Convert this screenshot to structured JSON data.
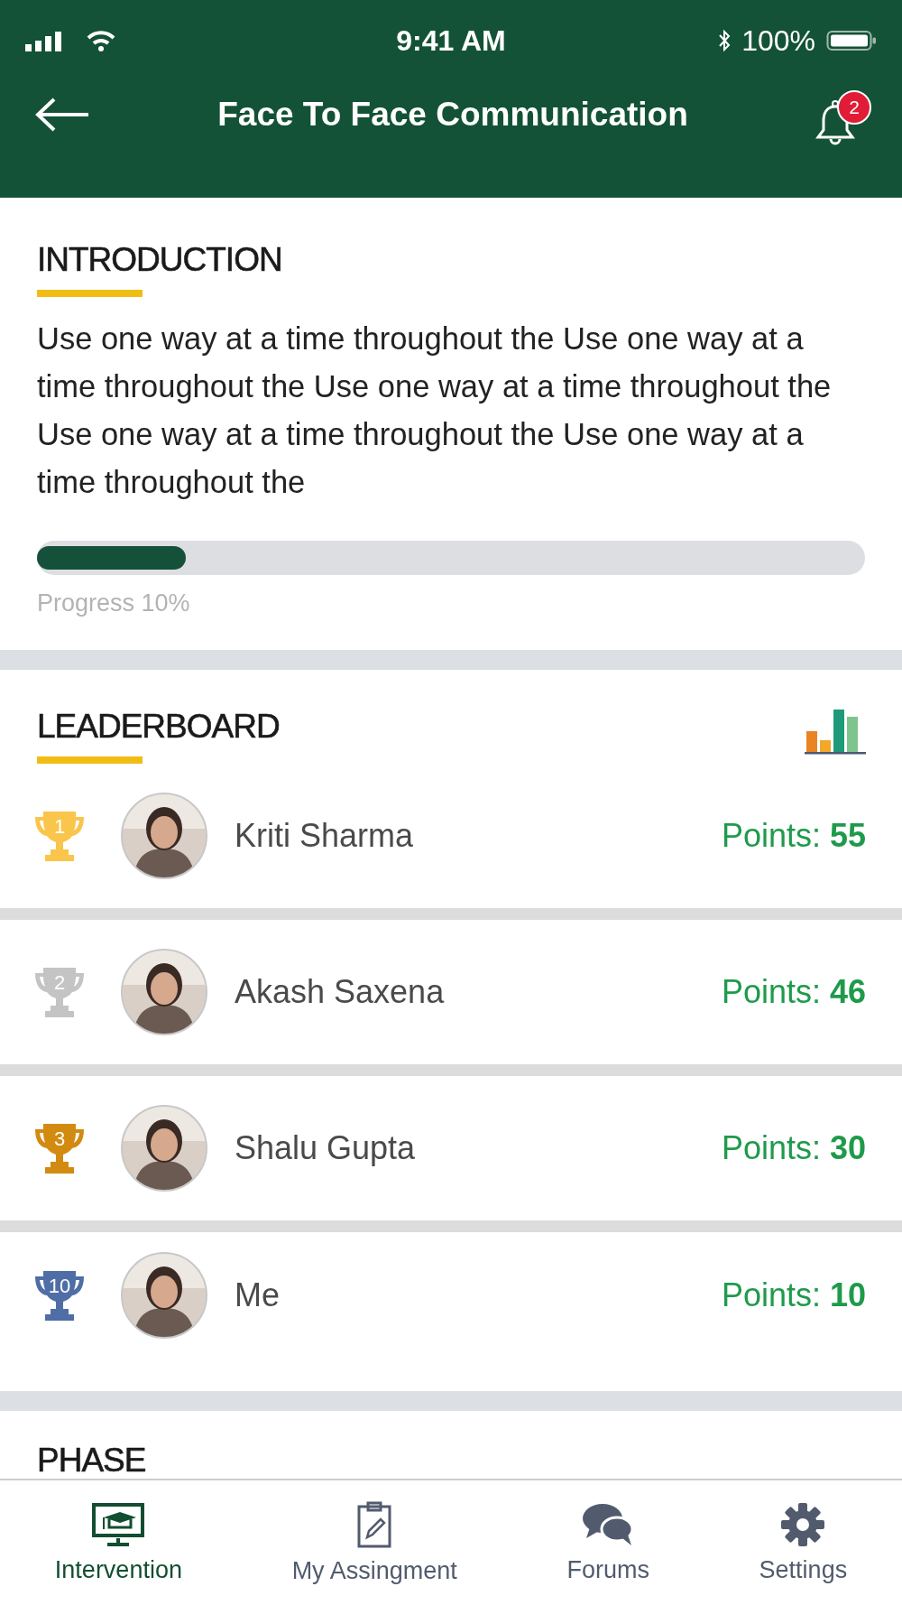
{
  "status_bar": {
    "time": "9:41 AM",
    "battery": "100%"
  },
  "header": {
    "title": "Face To Face Communication",
    "notification_count": "2"
  },
  "introduction": {
    "heading": "INTRODUCTION",
    "text": "Use one way at a time throughout the Use one way at a time throughout the  Use one way at a time throughout the Use one way at a time throughout the Use one way at a time throughout the",
    "progress": {
      "level": 0.18,
      "label": "Progress 10%"
    }
  },
  "leaderboard": {
    "heading": "LEADERBOARD",
    "rows": [
      {
        "rank": "1",
        "color": "#f9c54a",
        "name": "Kriti Sharma",
        "points": "Points: **55**"
      },
      {
        "rank": "2",
        "color": "#c4c4c4",
        "name": "Akash Saxena",
        "points": "Points: **46**"
      },
      {
        "rank": "3",
        "color": "#d38a10",
        "name": "Shalu Gupta",
        "points": "Points: **30**"
      },
      {
        "rank": "10",
        "color": "#4f6ea6",
        "name": "Me",
        "points": "Points: **10**"
      }
    ]
  },
  "phase": {
    "heading": "PHASE"
  },
  "bottom_nav": [
    {
      "kind": "intervention",
      "label": "Intervention",
      "selected": true
    },
    {
      "kind": "assignment",
      "label": "My Assingment",
      "selected": false
    },
    {
      "kind": "forums",
      "label": "Forums",
      "selected": false
    },
    {
      "kind": "settings",
      "label": "Settings",
      "selected": false
    }
  ]
}
